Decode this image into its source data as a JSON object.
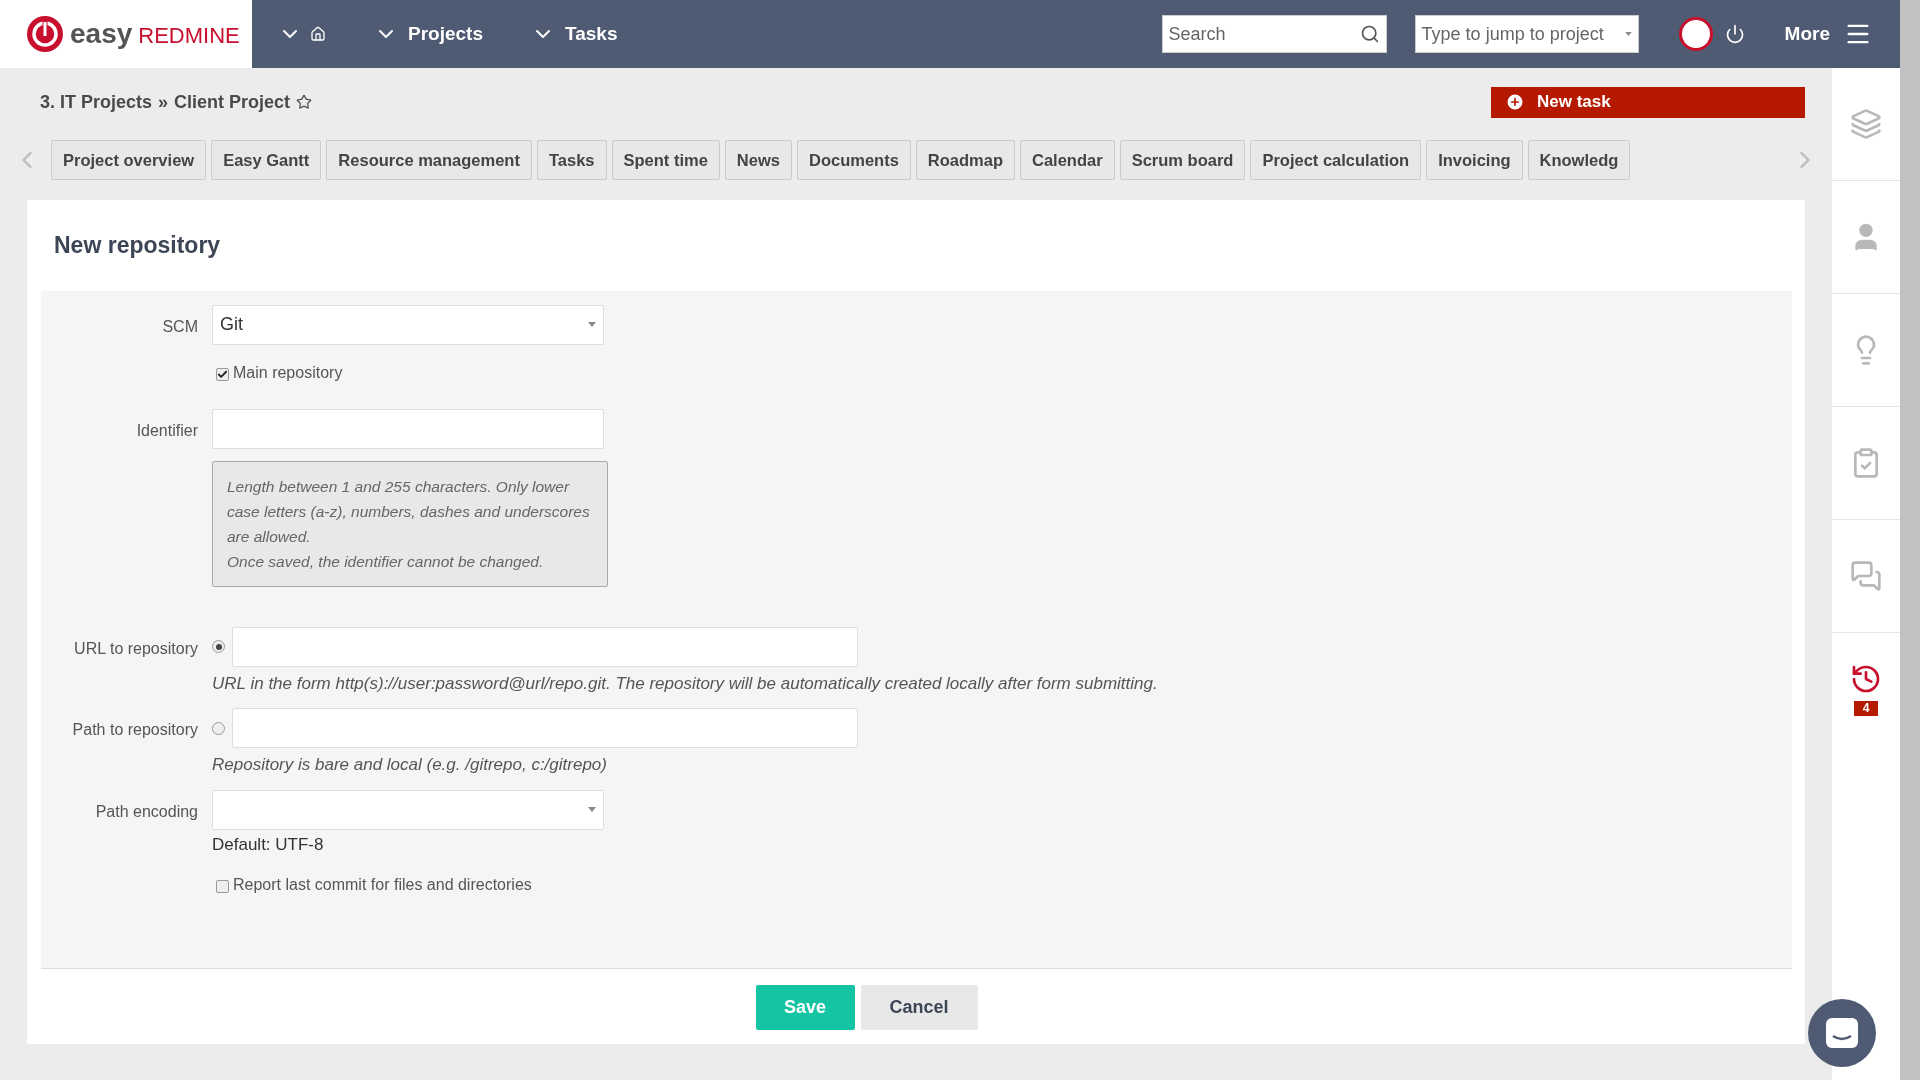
{
  "top_bar": {
    "logo": {
      "first": "easy",
      "second": "REDMINE"
    },
    "menu": [
      {
        "kind": "home"
      },
      {
        "kind": "text",
        "label": "Projects"
      },
      {
        "kind": "text",
        "label": "Tasks"
      }
    ],
    "search": {
      "placeholder": "Search"
    },
    "jump": {
      "placeholder": "Type to jump to project"
    },
    "more": "More"
  },
  "breadcrumb": {
    "items": [
      "3. IT Projects",
      "Client Project"
    ],
    "separator": "»",
    "favorite": false
  },
  "new_task": "New task",
  "tabs": [
    {
      "label": "Project overview",
      "selected": false
    },
    {
      "label": "Easy Gantt",
      "selected": false
    },
    {
      "label": "Resource management",
      "selected": false
    },
    {
      "label": "Tasks",
      "selected": false
    },
    {
      "label": "Spent time",
      "selected": false
    },
    {
      "label": "News",
      "selected": false
    },
    {
      "label": "Documents",
      "selected": false
    },
    {
      "label": "Roadmap",
      "selected": false
    },
    {
      "label": "Calendar",
      "selected": false
    },
    {
      "label": "Scrum board",
      "selected": false
    },
    {
      "label": "Project calculation",
      "selected": false
    },
    {
      "label": "Invoicing",
      "selected": false
    },
    {
      "label": "Knowledg",
      "selected": false
    }
  ],
  "form": {
    "title": "New repository",
    "fields": [
      {
        "kind": "select",
        "label": "SCM",
        "value": "Git"
      },
      {
        "kind": "checkbox",
        "label": "Main repository",
        "checked": true
      },
      {
        "kind": "text",
        "label": "Identifier",
        "note": [
          "Length between 1 and 255 characters. Only lower case letters (a-z), numbers, dashes and underscores are allowed.",
          "Once saved, the identifier cannot be changed."
        ]
      },
      {
        "kind": "radio",
        "label": "URL to repository",
        "selected": true,
        "hint": "URL in the form http(s)://user:password@url/repo.git. The repository will be automatically created locally after form submitting."
      },
      {
        "kind": "radio",
        "label": "Path to repository",
        "selected": false,
        "hint": "Repository is bare and local (e.g. /gitrepo, c:/gitrepo)"
      },
      {
        "kind": "select",
        "label": "Path encoding",
        "default_note": "Default: UTF-8"
      },
      {
        "kind": "checkbox",
        "label": "Report last commit for files and directories",
        "checked": false
      }
    ],
    "buttons": [
      {
        "kind": "primary",
        "label": "Save"
      },
      {
        "kind": "secondary",
        "label": "Cancel"
      }
    ]
  },
  "sidebar": [
    {
      "kind": "stack"
    },
    {
      "kind": "user"
    },
    {
      "kind": "bulb"
    },
    {
      "kind": "clipboard"
    },
    {
      "kind": "chat"
    },
    {
      "kind": "history",
      "badge": "4"
    }
  ]
}
